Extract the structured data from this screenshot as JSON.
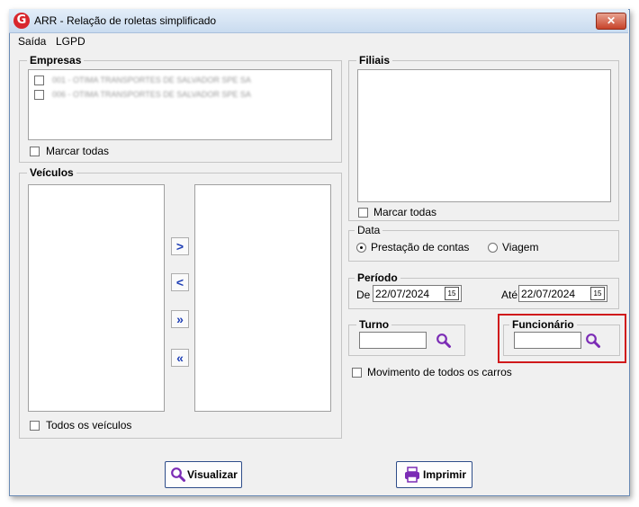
{
  "window": {
    "title": "ARR -  Relação de roletas simplificado",
    "logo_letter": "G",
    "close_glyph": "✕"
  },
  "menu": {
    "items": [
      {
        "label": "Saída"
      },
      {
        "label": "LGPD"
      }
    ]
  },
  "empresas": {
    "label": "Empresas",
    "items": [
      {
        "text": "001 - OTIMA TRANSPORTES DE SALVADOR SPE SA",
        "checked": false
      },
      {
        "text": "006 - OTIMA TRANSPORTES DE SALVADOR SPE SA",
        "checked": false
      }
    ],
    "mark_all": "Marcar todas"
  },
  "veiculos": {
    "label": "Veículos",
    "buttons": [
      ">",
      "<",
      "»",
      "«"
    ],
    "all_vehicles": "Todos os veículos"
  },
  "filiais": {
    "label": "Filiais",
    "mark_all": "Marcar todas"
  },
  "data": {
    "label": "Data",
    "options": [
      "Prestação de contas",
      "Viagem"
    ],
    "selected": "Prestação de contas"
  },
  "periodo": {
    "label": "Período",
    "from_label": "De",
    "from_value": "22/07/2024",
    "to_label": "Até",
    "to_value": "22/07/2024",
    "calendar_glyph": "15"
  },
  "turno": {
    "label": "Turno",
    "value": ""
  },
  "funcionario": {
    "label": "Funcionário",
    "value": ""
  },
  "movimento": {
    "label": "Movimento de todos os carros"
  },
  "actions": {
    "visualizar": "Visualizar",
    "imprimir": "Imprimir"
  },
  "colors": {
    "highlight": "#d0191b",
    "search_icon": "#7b2bb5",
    "arrow": "#1f3fb5",
    "logo": "#d8262d"
  }
}
